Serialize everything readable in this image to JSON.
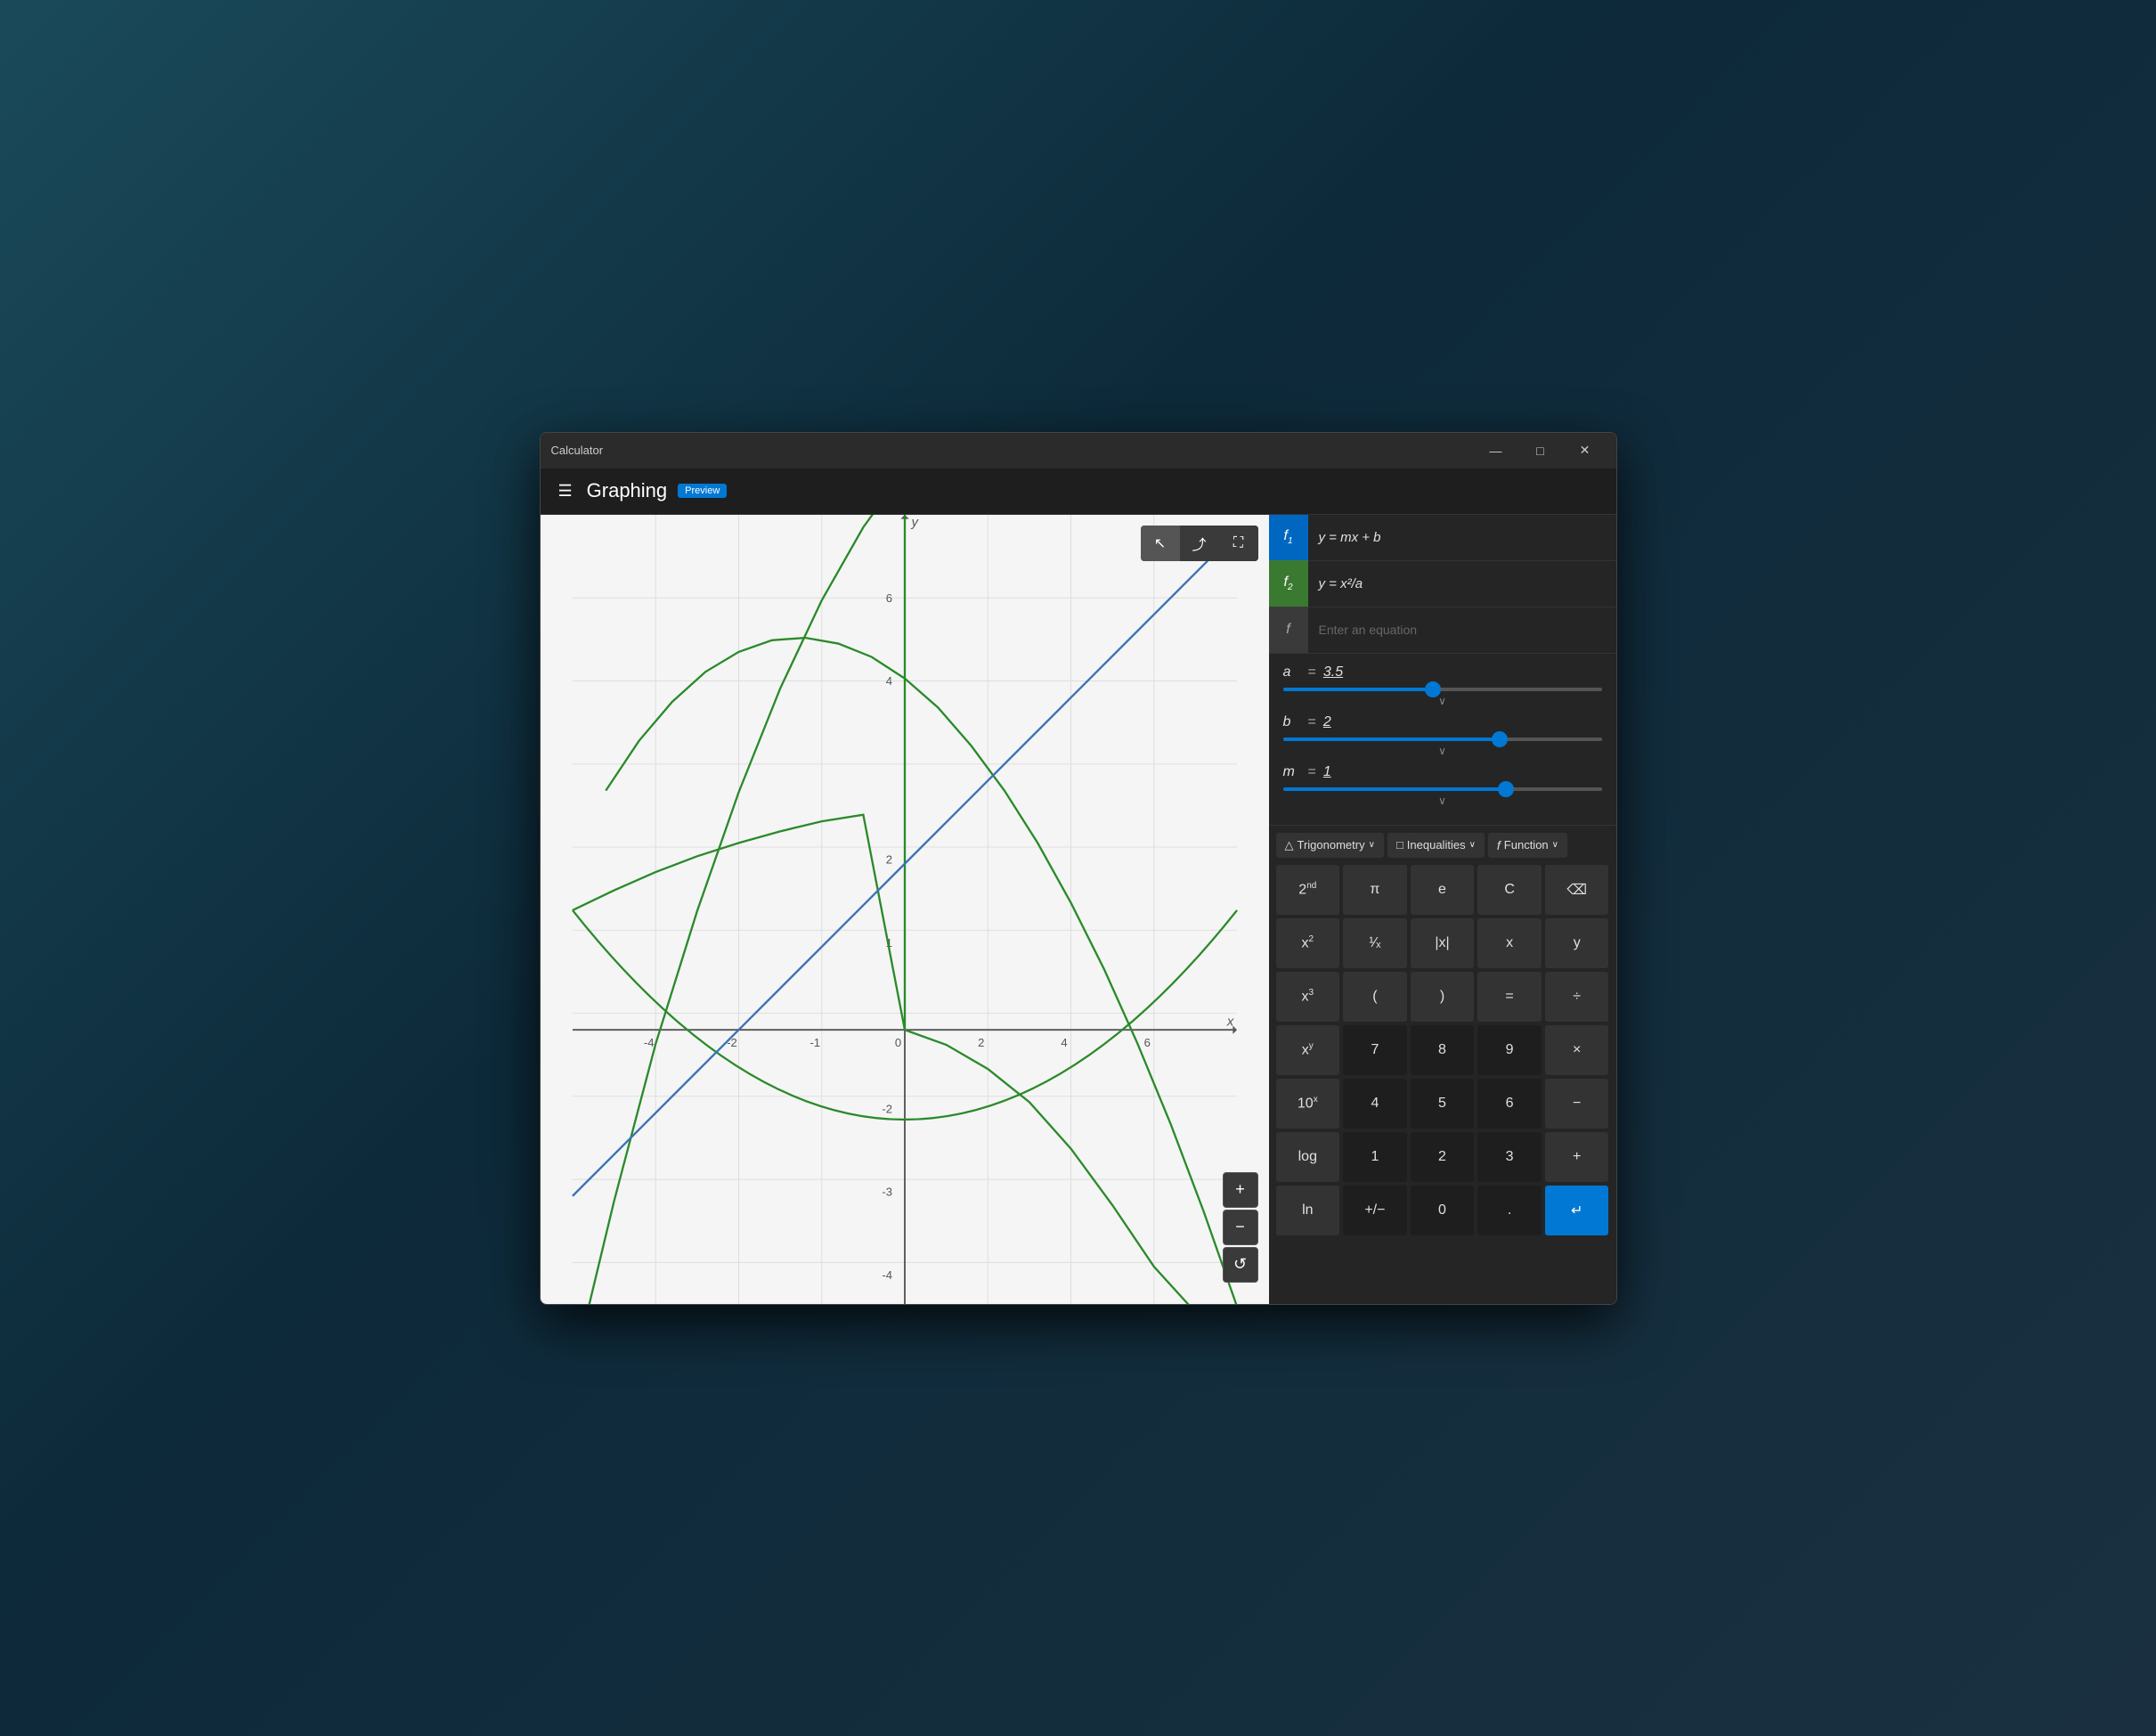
{
  "window": {
    "title": "Calculator",
    "minimize_label": "—",
    "maximize_label": "□",
    "close_label": "✕"
  },
  "header": {
    "title": "Graphing",
    "badge": "Preview",
    "hamburger": "☰"
  },
  "functions": [
    {
      "id": "f1",
      "badge": "f₁",
      "equation": "y = mx + b",
      "color": "blue",
      "badge_class": "f1"
    },
    {
      "id": "f2",
      "badge": "f₂",
      "equation": "y = x²/a",
      "color": "green",
      "badge_class": "f2"
    },
    {
      "id": "f3",
      "badge": "f",
      "equation": "",
      "placeholder": "Enter an equation",
      "badge_class": "f-empty"
    }
  ],
  "variables": [
    {
      "name": "a",
      "equals": "=",
      "value": "3.5",
      "slider_pct": 47
    },
    {
      "name": "b",
      "equals": "=",
      "value": "2",
      "slider_pct": 68
    },
    {
      "name": "m",
      "equals": "=",
      "value": "1",
      "slider_pct": 70
    }
  ],
  "keyboard": {
    "toolbar": [
      {
        "id": "trig",
        "label": "Trigonometry",
        "has_chevron": true,
        "icon": "△"
      },
      {
        "id": "inequalities",
        "label": "Inequalities",
        "has_chevron": true,
        "icon": "□"
      },
      {
        "id": "function",
        "label": "Function",
        "has_chevron": true,
        "icon": "f"
      }
    ],
    "rows": [
      [
        {
          "label": "2ⁿᵈ",
          "display": "2<sup>nd</sup>",
          "type": "normal"
        },
        {
          "label": "π",
          "display": "π",
          "type": "normal"
        },
        {
          "label": "e",
          "display": "e",
          "type": "normal"
        },
        {
          "label": "C",
          "display": "C",
          "type": "normal"
        },
        {
          "label": "⌫",
          "display": "⌫",
          "type": "normal"
        }
      ],
      [
        {
          "label": "x²",
          "display": "x<sup>2</sup>",
          "type": "normal"
        },
        {
          "label": "1/x",
          "display": "¹∕ₓ",
          "type": "normal"
        },
        {
          "label": "|x|",
          "display": "|x|",
          "type": "normal"
        },
        {
          "label": "x",
          "display": "x",
          "type": "normal"
        },
        {
          "label": "y",
          "display": "y",
          "type": "normal"
        }
      ],
      [
        {
          "label": "x³",
          "display": "x<sup>3</sup>",
          "type": "normal"
        },
        {
          "label": "(",
          "display": "(",
          "type": "normal"
        },
        {
          "label": ")",
          "display": ")",
          "type": "normal"
        },
        {
          "label": "=",
          "display": "=",
          "type": "normal"
        },
        {
          "label": "÷",
          "display": "÷",
          "type": "normal"
        }
      ],
      [
        {
          "label": "xʸ",
          "display": "x<sup>y</sup>",
          "type": "normal"
        },
        {
          "label": "7",
          "display": "7",
          "type": "dark"
        },
        {
          "label": "8",
          "display": "8",
          "type": "dark"
        },
        {
          "label": "9",
          "display": "9",
          "type": "dark"
        },
        {
          "label": "×",
          "display": "×",
          "type": "normal"
        }
      ],
      [
        {
          "label": "10ˣ",
          "display": "10<sup>x</sup>",
          "type": "normal"
        },
        {
          "label": "4",
          "display": "4",
          "type": "dark"
        },
        {
          "label": "5",
          "display": "5",
          "type": "dark"
        },
        {
          "label": "6",
          "display": "6",
          "type": "dark"
        },
        {
          "label": "−",
          "display": "−",
          "type": "normal"
        }
      ],
      [
        {
          "label": "log",
          "display": "log",
          "type": "normal"
        },
        {
          "label": "1",
          "display": "1",
          "type": "dark"
        },
        {
          "label": "2",
          "display": "2",
          "type": "dark"
        },
        {
          "label": "3",
          "display": "3",
          "type": "dark"
        },
        {
          "label": "+",
          "display": "+",
          "type": "normal"
        }
      ],
      [
        {
          "label": "ln",
          "display": "ln",
          "type": "normal"
        },
        {
          "label": "+/-",
          "display": "+/−",
          "type": "dark"
        },
        {
          "label": "0",
          "display": "0",
          "type": "dark"
        },
        {
          "label": ".",
          "display": ".",
          "type": "dark"
        },
        {
          "label": "↵",
          "display": "↵",
          "type": "accent"
        }
      ]
    ]
  },
  "zoom": {
    "plus": "+",
    "minus": "−",
    "reset": "↺"
  },
  "graph_tools": [
    {
      "id": "select",
      "icon": "↖",
      "label": "Select"
    },
    {
      "id": "share",
      "icon": "⤴",
      "label": "Share"
    },
    {
      "id": "expand",
      "icon": "⛶",
      "label": "Expand"
    }
  ],
  "graph": {
    "x_label": "x",
    "y_label": "y",
    "grid_lines": [
      -4,
      -2,
      2,
      4,
      6
    ],
    "x_ticks": [
      -4,
      -2,
      2,
      4
    ],
    "y_ticks": [
      -4,
      -2,
      2,
      4,
      6
    ]
  }
}
